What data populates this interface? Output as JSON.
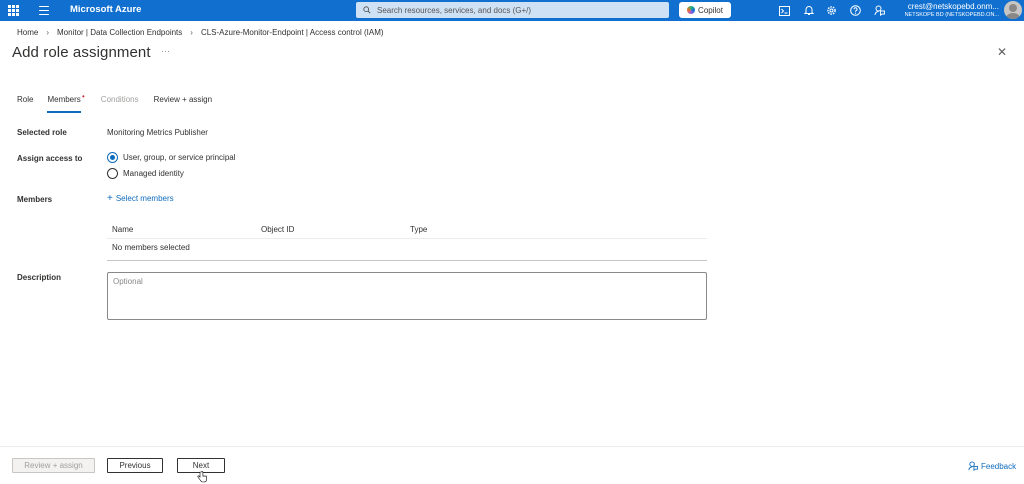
{
  "topbar": {
    "brand": "Microsoft Azure",
    "search_placeholder": "Search resources, services, and docs (G+/)",
    "copilot_label": "Copilot",
    "user_email": "crest@netskopebd.onm...",
    "user_tenant": "NETSKOPE BD (NETSKOPEBD.ON...",
    "icons": [
      "waffle-icon",
      "hamburger-icon",
      "cloud-shell-icon",
      "bell-icon",
      "gear-icon",
      "help-icon",
      "feedback-icon"
    ]
  },
  "breadcrumb": {
    "items": [
      "Home",
      "Monitor | Data Collection Endpoints",
      "CLS-Azure-Monitor-Endpoint | Access control (IAM)"
    ],
    "separator": "›"
  },
  "page": {
    "title": "Add role assignment",
    "more": "···",
    "close": "✕"
  },
  "tabs": [
    {
      "label": "Role",
      "state": "normal"
    },
    {
      "label": "Members",
      "state": "active"
    },
    {
      "label": "Conditions",
      "state": "disabled"
    },
    {
      "label": "Review + assign",
      "state": "normal"
    }
  ],
  "form": {
    "selected_role_label": "Selected role",
    "selected_role_value": "Monitoring Metrics Publisher",
    "assign_access_label": "Assign access to",
    "assign_options": [
      {
        "label": "User, group, or service principal",
        "selected": true
      },
      {
        "label": "Managed identity",
        "selected": false
      }
    ],
    "members_label": "Members",
    "select_members_link": "Select members",
    "members_table": {
      "columns": [
        "Name",
        "Object ID",
        "Type"
      ],
      "empty_text": "No members selected"
    },
    "description_label": "Description",
    "description_placeholder": "Optional"
  },
  "footer": {
    "review_assign": "Review + assign",
    "previous": "Previous",
    "next": "Next",
    "feedback": "Feedback"
  },
  "colors": {
    "topbar": "#1170cf",
    "accent": "#0f6cbd",
    "required": "#d13438"
  }
}
